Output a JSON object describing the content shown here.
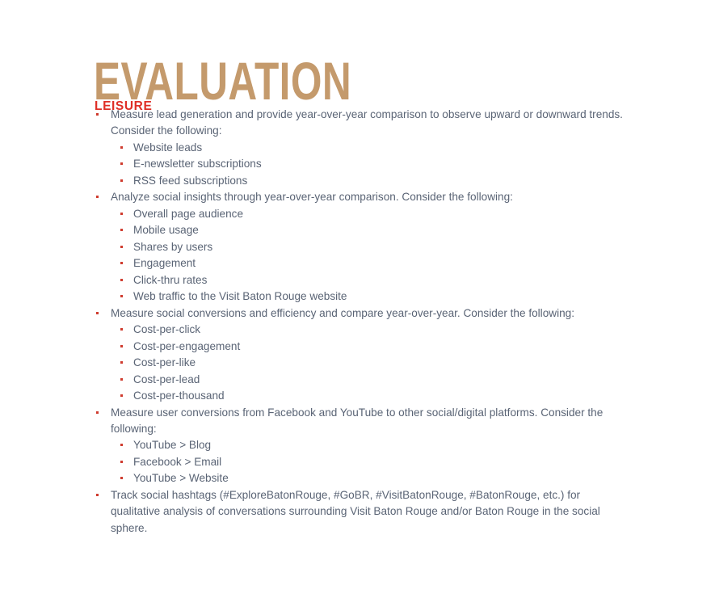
{
  "document": {
    "title": "EVALUATION",
    "section_heading": "LEISURE",
    "colors": {
      "title": "#c49a6c",
      "section_heading": "#df2f27",
      "body_text": "#5a6475",
      "bullet": "#cf3b2e",
      "background": "#ffffff"
    },
    "bullets": [
      {
        "text": "Measure lead generation and provide year-over-year comparison to observe upward or downward trends. Consider the following:",
        "children": [
          "Website leads",
          "E-newsletter subscriptions",
          "RSS feed subscriptions"
        ]
      },
      {
        "text": "Analyze social insights through year-over-year comparison. Consider the following:",
        "children": [
          "Overall page audience",
          "Mobile usage",
          "Shares by users",
          "Engagement",
          "Click-thru rates",
          "Web traffic to the Visit Baton Rouge website"
        ]
      },
      {
        "text": "Measure social conversions and efficiency and compare year-over-year. Consider the following:",
        "children": [
          "Cost-per-click",
          "Cost-per-engagement",
          "Cost-per-like",
          "Cost-per-lead",
          "Cost-per-thousand"
        ]
      },
      {
        "text": "Measure user conversions from Facebook and YouTube to other social/digital platforms. Consider the following:",
        "children": [
          "YouTube > Blog",
          "Facebook > Email",
          "YouTube > Website"
        ]
      },
      {
        "text": "Track social hashtags (#ExploreBatonRouge, #GoBR, #VisitBatonRouge, #BatonRouge, etc.) for qualitative analysis of conversations surrounding Visit Baton Rouge and/or Baton Rouge in the social sphere.",
        "children": []
      }
    ]
  }
}
